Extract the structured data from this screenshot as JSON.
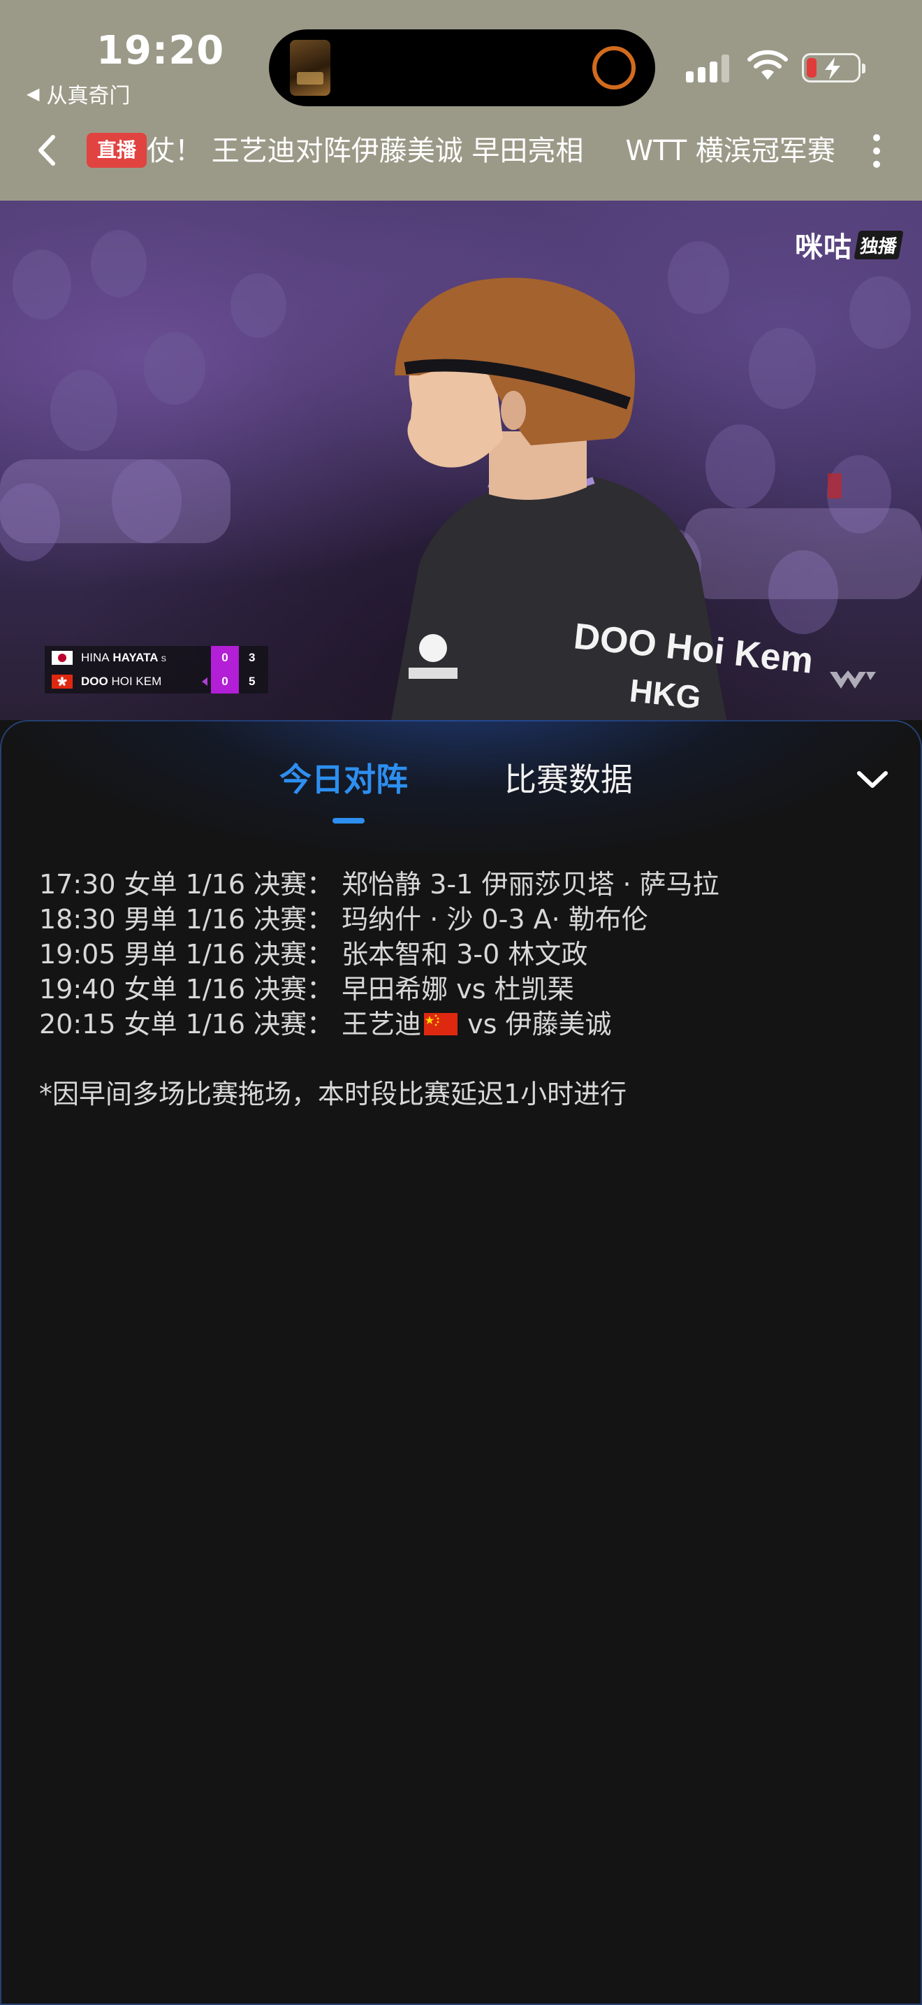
{
  "status_bar": {
    "time": "19:20",
    "back_to_app": "从真奇门",
    "back_arrow_icon": "triangle-left-icon",
    "signal_icon": "cellular-signal-icon",
    "wifi_icon": "wifi-icon",
    "battery_icon": "battery-charging-icon",
    "battery_level_color": "#e23b3b"
  },
  "header": {
    "back_icon": "chevron-left-icon",
    "live_badge": "直播",
    "ticker_segment_1": "仗！ 王艺迪对阵伊藤美诚 早田亮相",
    "ticker_segment_2": "WTT 横滨冠军赛",
    "more_icon": "more-vertical-icon"
  },
  "video": {
    "watermark_brand": "咪咕",
    "watermark_exclusive": "独播",
    "corner_logo_icon": "wtt-logo-icon",
    "scoreboard": {
      "player1": {
        "flag": "jp-flag-icon",
        "name_first": "HINA",
        "name_last": "HAYATA",
        "serve_mark": "S",
        "games": "0",
        "points": "3"
      },
      "player2": {
        "flag": "hk-flag-icon",
        "name_first": "DOO",
        "name_last": "HOI KEM",
        "games": "0",
        "points": "5"
      },
      "game_color": "#b21fd6"
    }
  },
  "sheet": {
    "tabs": [
      {
        "label": "今日对阵",
        "active": true
      },
      {
        "label": "比赛数据",
        "active": false
      }
    ],
    "accent_color": "#2d8ff0",
    "collapse_icon": "chevron-down-icon",
    "schedule": [
      {
        "text": "17:30 女单 1/16 决赛：  郑怡静 3-1 伊丽莎贝塔 · 萨马拉"
      },
      {
        "text": "18:30 男单 1/16 决赛：  玛纳什 · 沙 0-3 A· 勒布伦"
      },
      {
        "text": "19:05 男单 1/16 决赛：  张本智和 3-0 林文政"
      },
      {
        "text": "19:40 女单 1/16 决赛：  早田希娜 vs 杜凯琹"
      },
      {
        "text_before_flag": "20:15 女单 1/16 决赛：  王艺迪",
        "flag": "china-flag-icon",
        "text_after_flag": "vs 伊藤美诚"
      }
    ],
    "note": "*因早间多场比赛拖场，本时段比赛延迟1小时进行"
  }
}
